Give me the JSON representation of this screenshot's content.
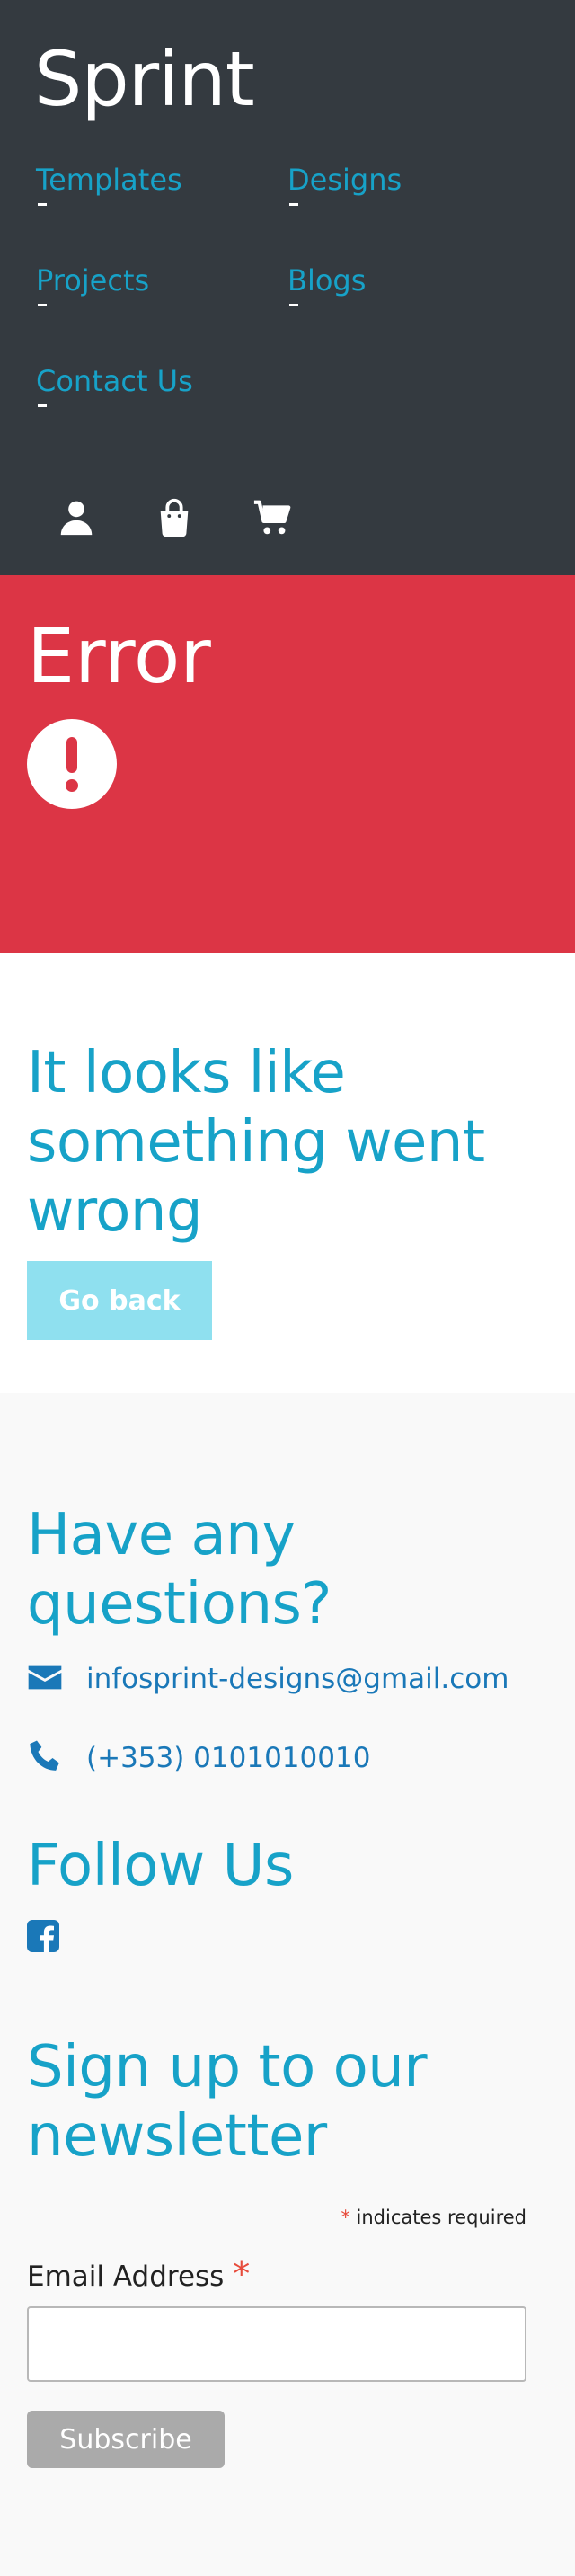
{
  "header": {
    "brand": "Sprint",
    "nav": [
      "Templates",
      "Designs",
      "Projects",
      "Blogs",
      "Contact Us"
    ],
    "icons": [
      "user-icon",
      "shopping-bag-icon",
      "shopping-cart-icon"
    ]
  },
  "error_banner": {
    "title": "Error",
    "icon": "exclamation-circle-icon"
  },
  "message": {
    "heading": "It looks like something went wrong",
    "button_label": "Go back"
  },
  "footer": {
    "questions_heading": "Have any questions?",
    "email": "infosprint-designs@gmail.com",
    "phone": "(+353) 0101010010",
    "follow_heading": "Follow Us",
    "social": [
      "facebook-icon"
    ],
    "newsletter_heading": "Sign up to our newsletter",
    "required_note": "indicates required",
    "required_mark": "*",
    "email_label": "Email Address",
    "email_value": "",
    "subscribe_label": "Subscribe"
  },
  "colors": {
    "header_bg": "#343a40",
    "accent": "#17a2c8",
    "error_bg": "#dc3545",
    "button_light": "#8fe0ef",
    "link": "#1a78b8",
    "subscribe_bg": "#aaaaaa"
  }
}
